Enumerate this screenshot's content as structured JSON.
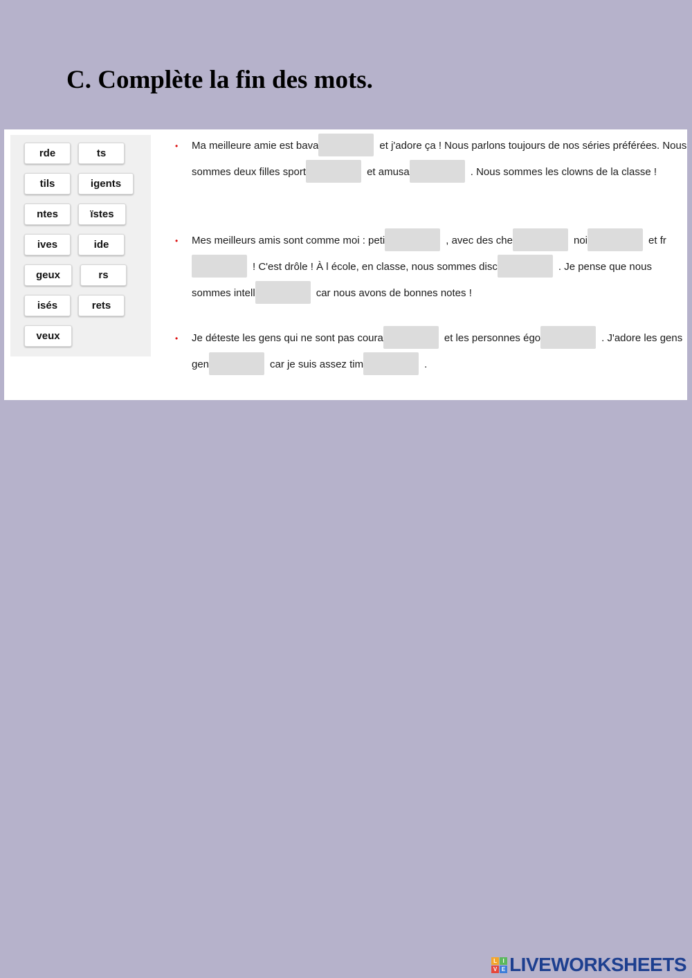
{
  "title": "C. Complète la fin des mots.",
  "word_bank": [
    "rde",
    "ts",
    "tils",
    "igents",
    "ntes",
    "ïstes",
    "ives",
    "ide",
    "geux",
    "rs",
    "isés",
    "rets",
    "veux"
  ],
  "exercises": [
    {
      "segments": [
        "Ma meilleure amie est bava",
        "et j'adore ça ! Nous parlons toujours de nos séries préférées. Nous sommes deux filles sport",
        "et amusa",
        ". Nous sommes les clowns de la classe !"
      ]
    },
    {
      "segments": [
        "Mes meilleurs amis sont comme moi : peti",
        ", avec des che",
        "noi",
        "et fr",
        "! C'est drôle ! À l école, en classe, nous sommes disc",
        ". Je pense que nous sommes intell",
        "car nous avons de bonnes notes !"
      ]
    },
    {
      "segments": [
        "Je déteste les gens qui ne sont pas coura",
        "et les personnes égo",
        ". J'adore les gens gen",
        "car je suis assez tim",
        "."
      ]
    }
  ],
  "logo": {
    "text": "LIVEWORKSHEETS",
    "mark_letters": [
      "L",
      "I",
      "V",
      "E"
    ],
    "mark_colors": [
      "#f4a62a",
      "#5bb85d",
      "#e5473c",
      "#3d7dd8"
    ]
  },
  "colors": {
    "background": "#b6b2cb",
    "bullet": "#dd1111",
    "blank": "#dcdcdc",
    "logo_text": "#1d3f8f"
  }
}
